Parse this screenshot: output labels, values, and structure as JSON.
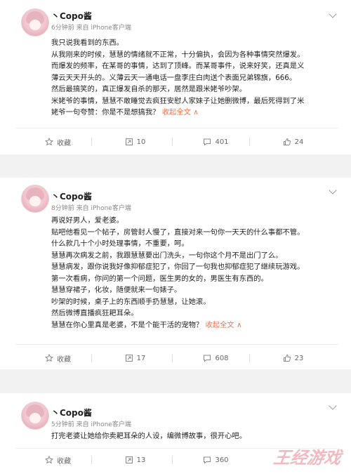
{
  "posts": [
    {
      "user": "丶Copo酱",
      "meta": "6分钟前 来自 iPhone客户端",
      "lines": [
        "我只说我看到的东西。",
        "从我刚来的时候，慧慧的情绪就不正常，十分偏执，会因为各种事情突然爆发。",
        "而爆发的频率，在某哥的事情，达到了顶峰。而某哥事件，说来好笑，还真是义",
        "薄云天天开头的。义薄云天一通电话一盘李庄白肉送个表面兄弟锦旗，666。",
        "然后最搞笑的，真正爆发自杀的那天，居然是跟米姥爷吵架。",
        "米姥爷的事情，慧慧不敢睡觉去疯狂安慰人家妹子让她删微博，最后死得到了米",
        "姥爷一句夸赞：你是不是想搞我？"
      ],
      "expand": "收起全文 ∧",
      "actions": {
        "favorite": "收藏",
        "repost": "10",
        "comment": "401",
        "like": "24"
      }
    },
    {
      "user": "丶Copo酱",
      "meta": "8分钟前 来自 iPhone客户端",
      "lines": [
        "再说好男人，爱老婆。",
        "贴吧他看见一个帖子，房管封人慢了，直接对来一句你一天天的什么事都不管。",
        "什么款几十个小时处理事情，不重要，呵。",
        "慧慧再次病发之前，我跟慧慧要出门洗头，一句你这个月不是出门了么。",
        "慧慧病发，跟你说我好像抑郁症犯了，你回了一句我也抑郁症犯了继续玩游戏。",
        "第一次看病，你问的第一个问题，医生男的女的，男医生有东西的。",
        "慧慧穿裙子，化妆，随便就来一句婊子。",
        "吵架的时候，桌子上的东西顺手扔慧慧，让她滚。",
        "然后微博直播疯狂耙耳朵。",
        "慧慧在你心里真是老婆，不是个能干活的宠物？"
      ],
      "expand": "收起全文 ∧",
      "actions": {
        "favorite": "收藏",
        "repost": "17",
        "comment": "608",
        "like": "23"
      }
    },
    {
      "user": "丶Copo酱",
      "meta": "5分钟前 来自 iPhone客户端",
      "lines": [
        "打完老婆让她给你卖耙耳朵的人设，编微博故事，很开心吧。"
      ],
      "expand": "",
      "actions": {
        "favorite": "收藏",
        "repost": "13",
        "comment": "360",
        "like": ""
      }
    }
  ],
  "watermark": "王经游戏",
  "colors": {
    "expand": "#eb7350",
    "separator": "#f2f2f2",
    "meta": "#888888"
  }
}
